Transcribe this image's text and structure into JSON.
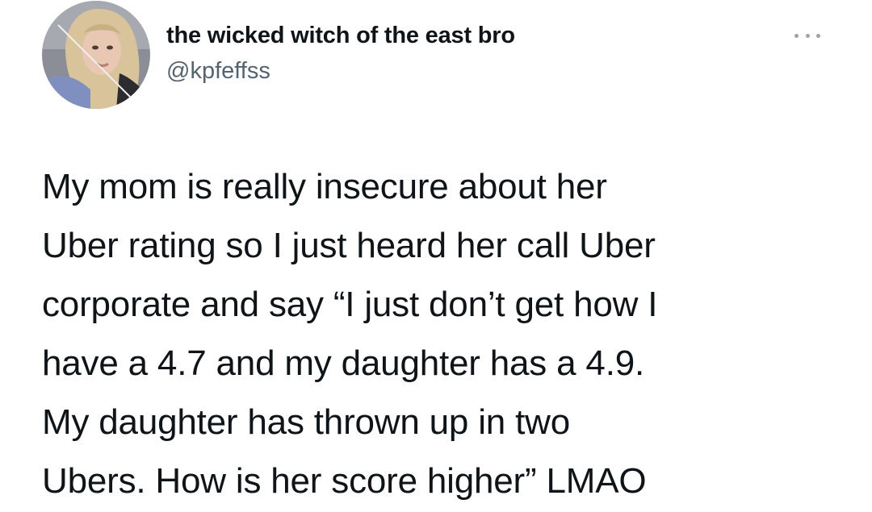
{
  "tweet": {
    "author": {
      "display_name": "the wicked witch of the east bro",
      "handle": "@kpfeffss"
    },
    "more_icon": "more-horizontal-icon",
    "text_lines": [
      "My mom is really insecure about her",
      "Uber rating so I just heard her call Uber",
      "corporate and say “I just don’t get how I",
      "have a 4.7 and my daughter has a 4.9.",
      "My daughter has thrown up in two",
      "Ubers. How is her score higher” LMAO"
    ]
  },
  "colors": {
    "text": "#0f1419",
    "secondary": "#536471",
    "icon": "#9aa4ad",
    "background": "#ffffff"
  }
}
